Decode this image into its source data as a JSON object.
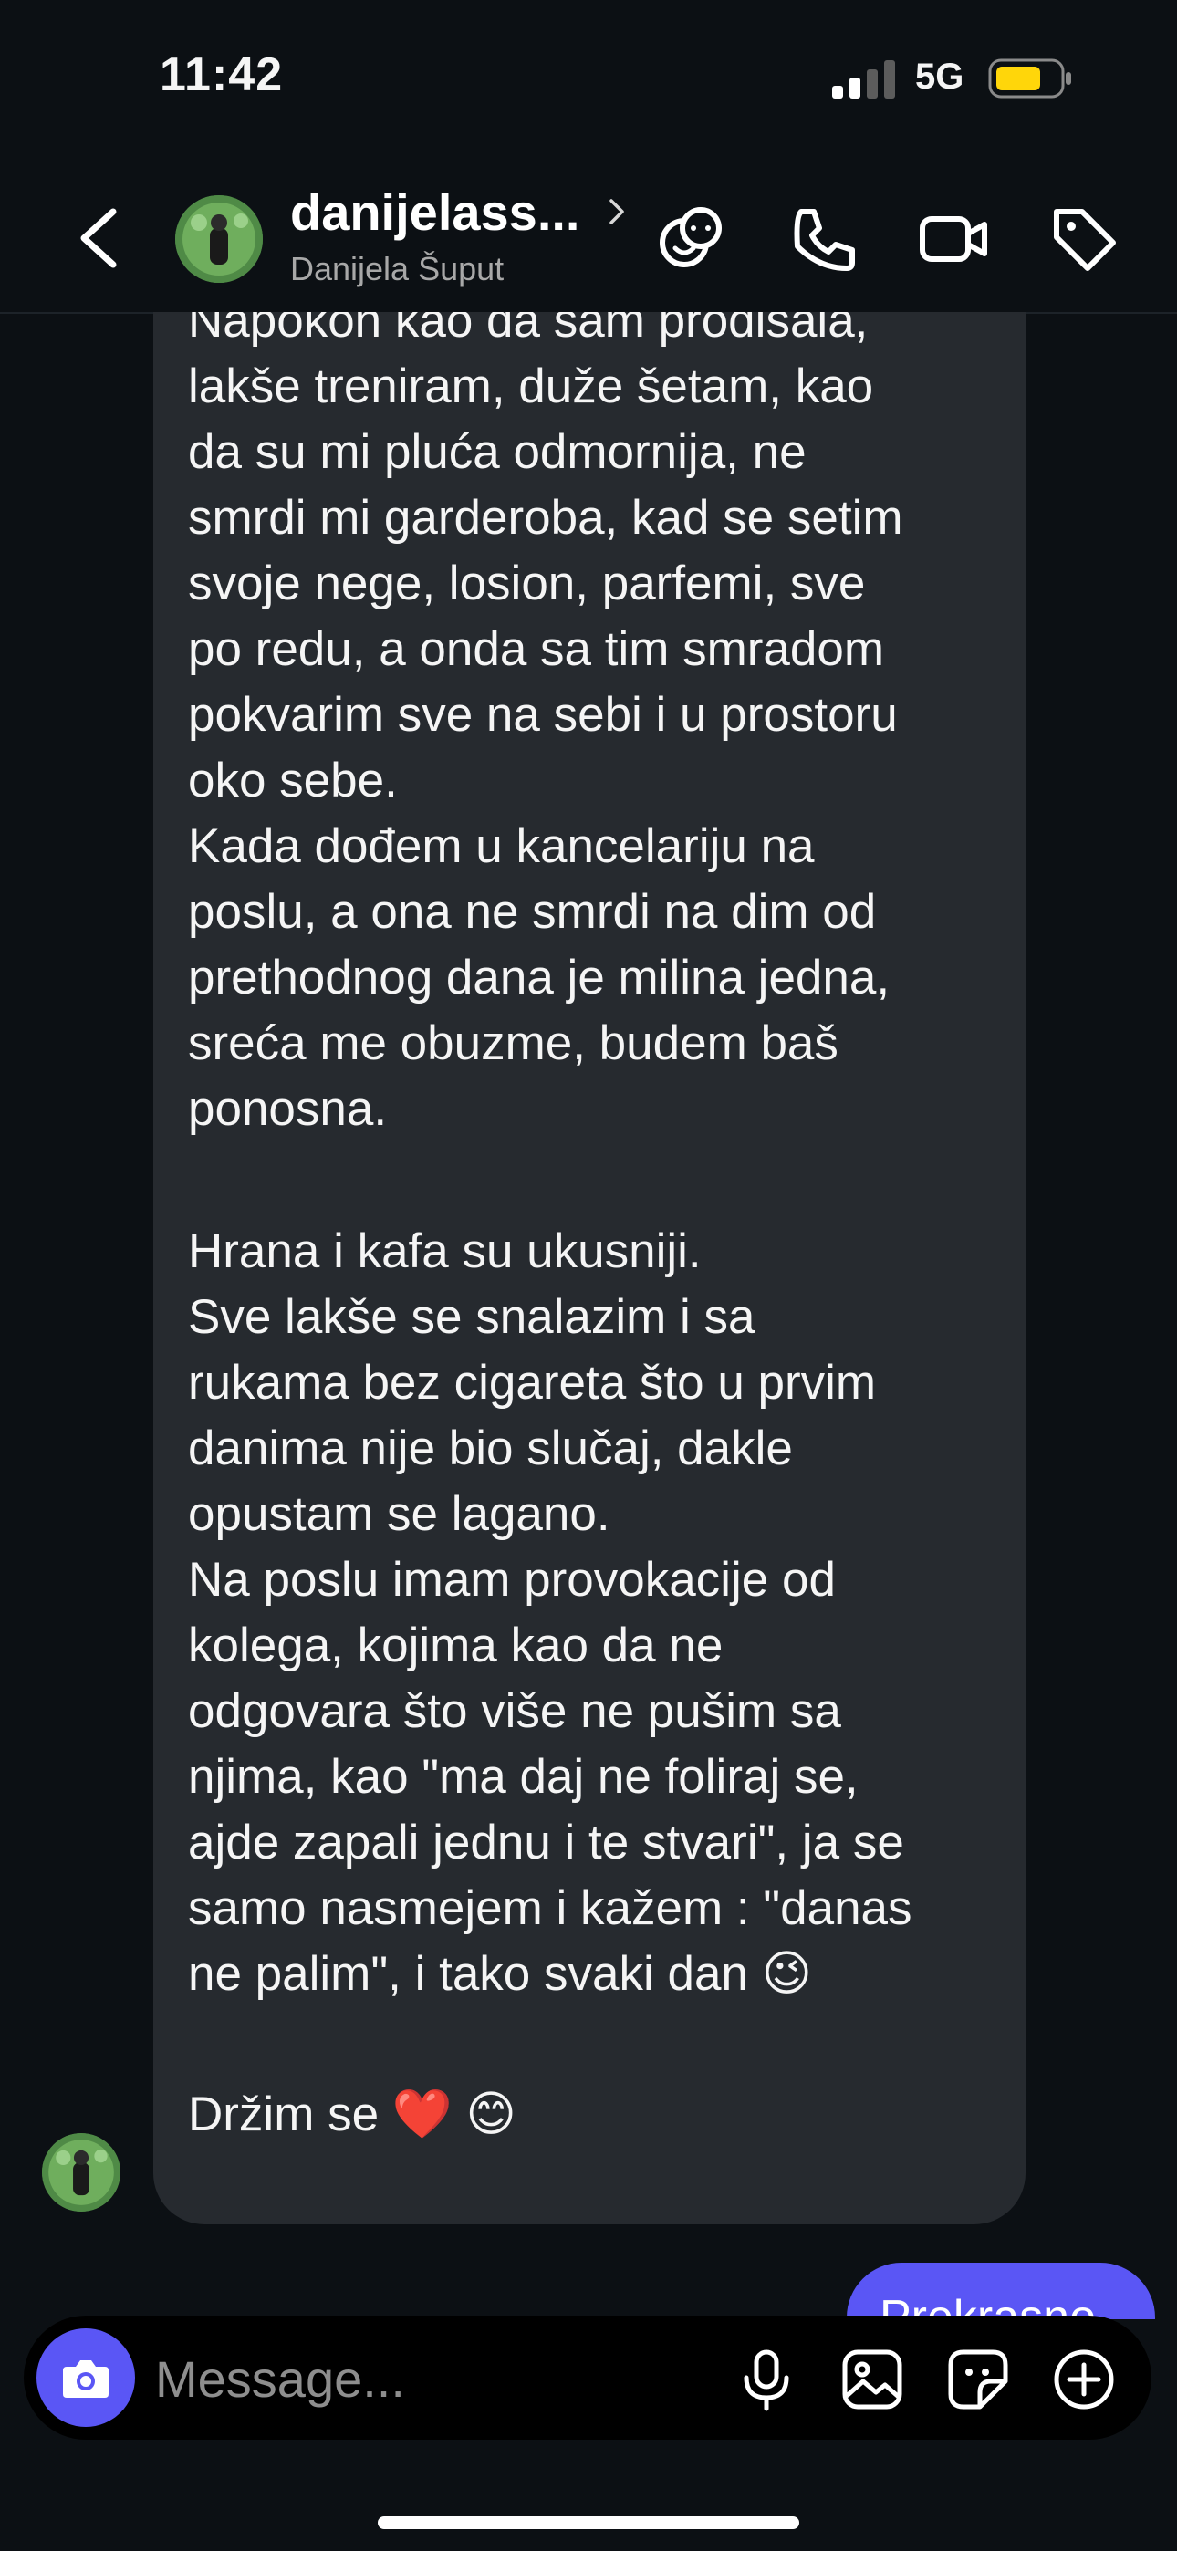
{
  "status": {
    "time": "11:42",
    "network": "5G"
  },
  "header": {
    "username": "danijelass...",
    "fullname": "Danijela Šuput",
    "icons": [
      "back-icon",
      "chevron-right-icon",
      "effects-icon",
      "phone-icon",
      "video-icon",
      "tag-icon"
    ]
  },
  "message": {
    "lines": [
      "Napokon kao da sam prodisala,",
      "lakše treniram, duže šetam, kao",
      "da su mi pluća odmornija, ne",
      "smrdi mi garderoba, kad se setim",
      "svoje nege, losion, parfemi, sve",
      "po redu, a onda sa tim smradom",
      "pokvarim sve na sebi i u prostoru",
      "oko sebe.",
      "Kada dođem u kancelariju na",
      "poslu, a ona ne smrdi na dim od",
      "prethodnog dana je milina jedna,",
      "sreća me obuzme, budem baš",
      "ponosna.",
      "Hrana i kafa su ukusniji.",
      "Sve lakše se snalazim i sa",
      "rukama bez cigareta što u prvim",
      "danima nije bio slučaj, dakle",
      "opustam se lagano.",
      "Na poslu imam provokacije od",
      "kolega, kojima kao da ne",
      "odgovara što više ne pušim sa",
      "njima, kao \"ma daj ne foliraj se,",
      "ajde zapali jednu i te stvari\", ja se",
      "samo nasmejem i kažem : \"danas",
      "ne palim\", i tako svaki dan 😉",
      "Držim se ❤️ 😊"
    ]
  },
  "reply_preview": "Prekrasno",
  "composer": {
    "placeholder": "Message..."
  },
  "colors": {
    "background": "#0c1014",
    "incoming_bubble": "#262a2f",
    "outgoing_bubble": "#5a56f5",
    "battery": "#ffd60a"
  }
}
